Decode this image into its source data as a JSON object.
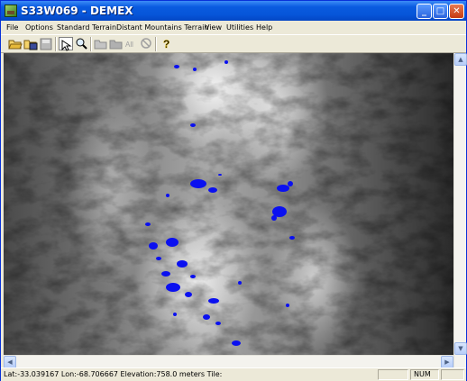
{
  "window": {
    "title": "S33W069 - DEMEX"
  },
  "title_buttons": {
    "minimize": "_",
    "maximize": "□",
    "close": "✕"
  },
  "menu": [
    "File",
    "Options",
    "Standard Terrain",
    "Distant Mountains Terrain",
    "View",
    "Utilities",
    "Help"
  ],
  "toolbar": {
    "tools": [
      "open-folder-icon",
      "save-as-icon",
      "save-icon",
      "select-arrow-icon",
      "zoom-icon",
      "folder-gray-icon",
      "folder-gray-2-icon",
      "all-icon",
      "no-icon",
      "help-icon"
    ],
    "all_label": "All",
    "help_label": "?"
  },
  "map": {
    "lake_color": "#0000ff",
    "terrain_colors": [
      "#2a2a2a",
      "#ffffff"
    ]
  },
  "status": {
    "text": "Lat:-33.039167 Lon:-68.706667 Elevation:758.0 meters Tile:",
    "num": "NUM"
  }
}
